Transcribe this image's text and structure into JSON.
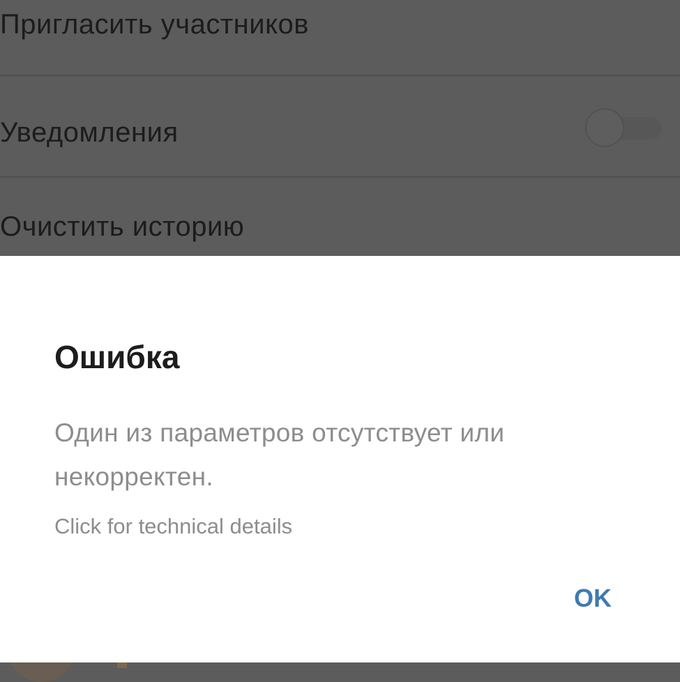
{
  "settings": {
    "invite_label": "Пригласить участников",
    "notifications_label": "Уведомления",
    "notifications_enabled": false,
    "clear_history_label": "Очистить историю"
  },
  "dialog": {
    "title": "Ошибка",
    "message": "Один из параметров отсутствует или некорректен.",
    "details_link": "Click for technical details",
    "ok_label": "OK"
  },
  "colors": {
    "accent": "#3f7ab0",
    "overlay": "#5c5c5c",
    "dialog_background": "#ffffff",
    "message_text": "#8d8d8d"
  }
}
